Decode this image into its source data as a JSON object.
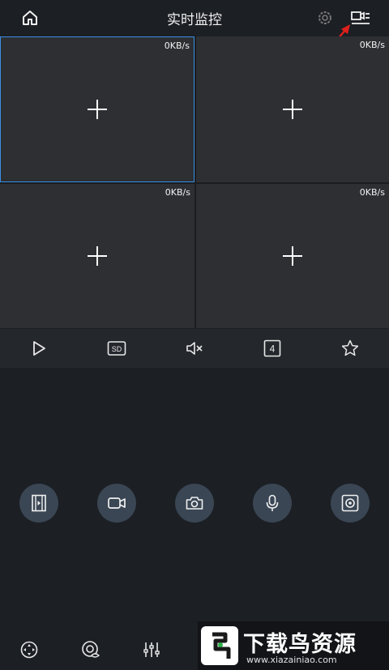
{
  "header": {
    "title": "实时监控",
    "home_icon": "home-icon",
    "settings_icon": "gear-icon",
    "layout_icon": "camera-list-icon"
  },
  "grid": {
    "tiles": [
      {
        "rate": "0KB/s",
        "selected": true
      },
      {
        "rate": "0KB/s",
        "selected": false
      },
      {
        "rate": "0KB/s",
        "selected": false
      },
      {
        "rate": "0KB/s",
        "selected": false
      }
    ]
  },
  "toolbar": {
    "items": [
      {
        "icon": "play-icon"
      },
      {
        "icon": "sd-quality-icon",
        "label": "SD"
      },
      {
        "icon": "mute-icon"
      },
      {
        "icon": "split-count-icon",
        "label": "4"
      },
      {
        "icon": "star-icon"
      }
    ]
  },
  "actions": [
    {
      "icon": "video-record-icon"
    },
    {
      "icon": "camera-icon"
    },
    {
      "icon": "photo-icon"
    },
    {
      "icon": "microphone-icon"
    },
    {
      "icon": "capture-icon"
    }
  ],
  "bottom_nav": [
    {
      "icon": "ptz-icon"
    },
    {
      "icon": "eye-icon"
    },
    {
      "icon": "adjust-icon"
    }
  ],
  "watermark": {
    "title": "下载鸟资源",
    "url": "www.xiazainiao.com"
  },
  "colors": {
    "accent": "#3a8ee6",
    "annotation_arrow": "#e0201c",
    "action_button_bg": "#3a4654"
  }
}
